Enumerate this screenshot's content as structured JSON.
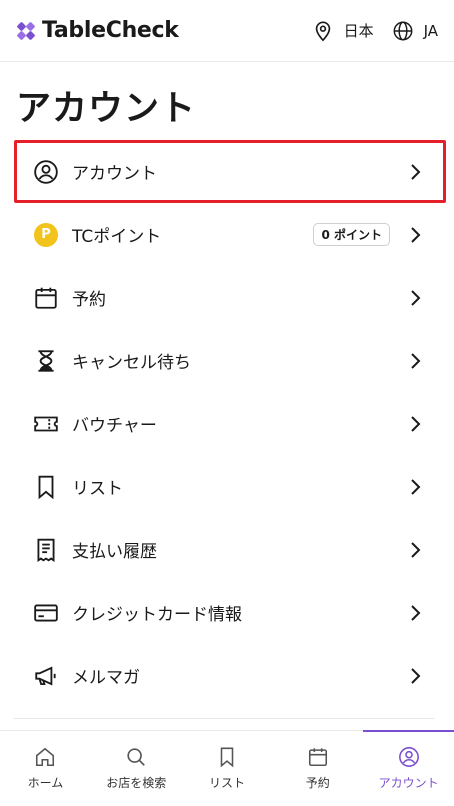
{
  "header": {
    "brand": "TableCheck",
    "location": "日本",
    "language": "JA"
  },
  "page": {
    "title": "アカウント"
  },
  "menu": {
    "items": [
      {
        "label": "アカウント",
        "icon": "user-circle-icon",
        "selected": true
      },
      {
        "label": "TCポイント",
        "icon": "points-coin-icon",
        "badge": "0 ポイント",
        "coin": "P"
      },
      {
        "label": "予約",
        "icon": "calendar-icon"
      },
      {
        "label": "キャンセル待ち",
        "icon": "hourglass-icon"
      },
      {
        "label": "バウチャー",
        "icon": "ticket-icon"
      },
      {
        "label": "リスト",
        "icon": "bookmark-icon"
      },
      {
        "label": "支払い履歴",
        "icon": "receipt-icon"
      },
      {
        "label": "クレジットカード情報",
        "icon": "credit-card-icon"
      },
      {
        "label": "メルマガ",
        "icon": "megaphone-icon"
      }
    ]
  },
  "tabs": [
    {
      "label": "ホーム",
      "icon": "home-icon"
    },
    {
      "label": "お店を検索",
      "icon": "search-icon"
    },
    {
      "label": "リスト",
      "icon": "bookmark-icon"
    },
    {
      "label": "予約",
      "icon": "calendar-icon"
    },
    {
      "label": "アカウント",
      "icon": "user-circle-icon",
      "active": true
    }
  ],
  "colors": {
    "accent": "#7b4fcf",
    "highlight": "#e5202a",
    "coin": "#f2c31b"
  }
}
